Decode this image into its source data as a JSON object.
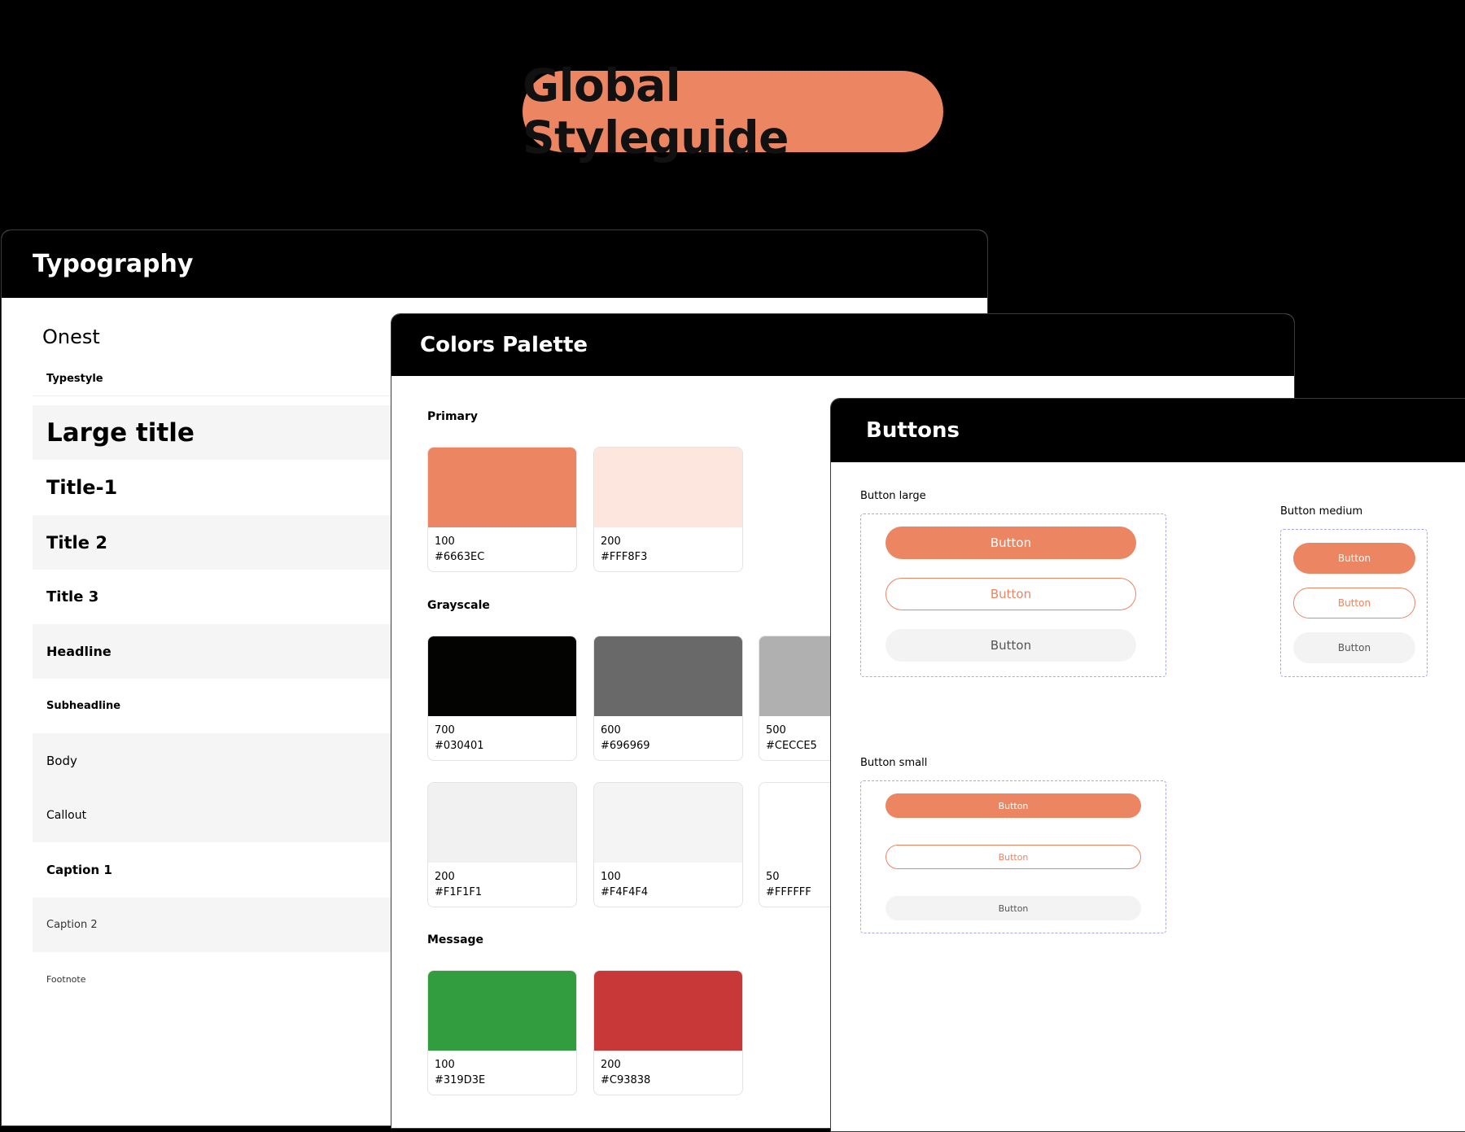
{
  "header": {
    "title": "Global Styleguide"
  },
  "colors_theme": {
    "accent": "#EB8562",
    "panel_header": "#000000",
    "group_border": "#A9A9EE"
  },
  "typography": {
    "title": "Typography",
    "font_name": "Onest",
    "typestyle_label": "Typestyle",
    "styles": [
      "Large title",
      "Title-1",
      "Title 2",
      "Title 3",
      "Headline",
      "Subheadline",
      "Body",
      "Callout",
      "Caption 1",
      "Caption 2",
      "Footnote"
    ]
  },
  "colors": {
    "title": "Colors Palette",
    "sections": [
      {
        "label": "Primary",
        "swatches": [
          {
            "level": "100",
            "hex": "#6663EC",
            "color": "#EB8562"
          },
          {
            "level": "200",
            "hex": "#FFF8F3",
            "color": "#FDE6DE"
          }
        ]
      },
      {
        "label": "Grayscale",
        "swatches": [
          {
            "level": "700",
            "hex": "#030401",
            "color": "#030401"
          },
          {
            "level": "600",
            "hex": "#696969",
            "color": "#696969"
          },
          {
            "level": "500",
            "hex": "#CECCE5",
            "color": "#B0B0B0"
          },
          {
            "level": "200",
            "hex": "#F1F1F1",
            "color": "#F1F1F1"
          },
          {
            "level": "100",
            "hex": "#F4F4F4",
            "color": "#F4F4F4"
          },
          {
            "level": "50",
            "hex": "#FFFFFF",
            "color": "#FFFFFF"
          }
        ]
      },
      {
        "label": "Message",
        "swatches": [
          {
            "level": "100",
            "hex": "#319D3E",
            "color": "#319D3E"
          },
          {
            "level": "200",
            "hex": "#C93838",
            "color": "#C93838"
          }
        ]
      }
    ]
  },
  "buttons": {
    "title": "Buttons",
    "large_label": "Button large",
    "medium_label": "Button medium",
    "small_label": "Button small",
    "button_text": "Button"
  }
}
